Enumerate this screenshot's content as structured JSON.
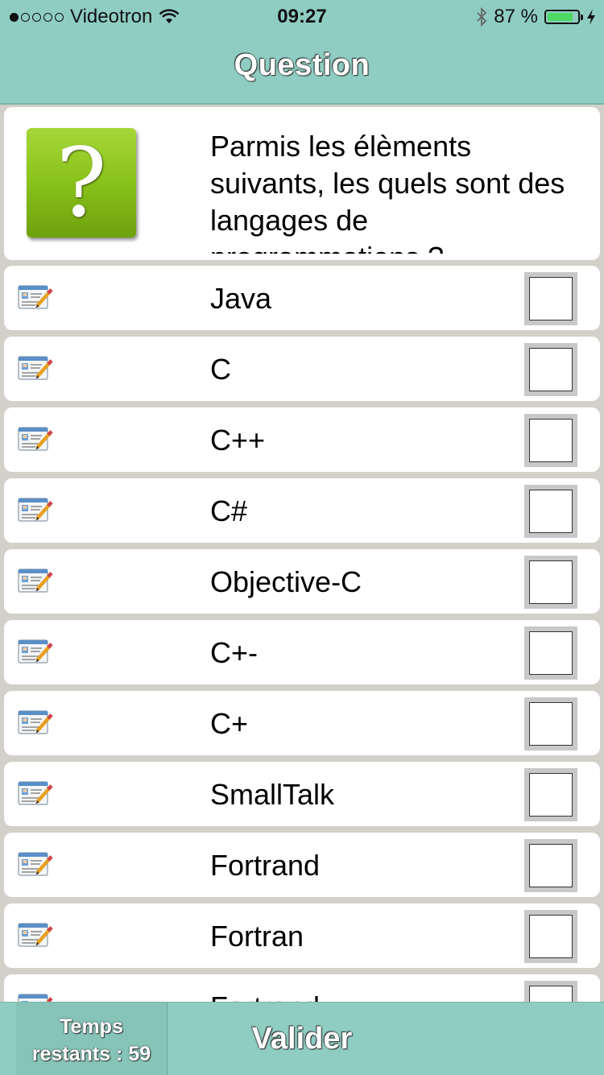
{
  "status_bar": {
    "carrier": "Videotron",
    "signal_dots_filled": 1,
    "signal_dots_total": 5,
    "time": "09:27",
    "battery_percent_label": "87 %",
    "battery_level": 0.87
  },
  "nav": {
    "title": "Question"
  },
  "question": {
    "text": "Parmis les élèments suivants, les quels sont des langages de programmations ?"
  },
  "options": [
    {
      "label": "Java",
      "checked": false
    },
    {
      "label": "C",
      "checked": false
    },
    {
      "label": "C++",
      "checked": false
    },
    {
      "label": "C#",
      "checked": false
    },
    {
      "label": "Objective-C",
      "checked": false
    },
    {
      "label": "C+-",
      "checked": false
    },
    {
      "label": "C+",
      "checked": false
    },
    {
      "label": "SmallTalk",
      "checked": false
    },
    {
      "label": "Fortrand",
      "checked": false
    },
    {
      "label": "Fortran",
      "checked": false
    },
    {
      "label": "Fortrand",
      "checked": false
    }
  ],
  "toolbar": {
    "timer_line1": "Temps",
    "timer_line2": "restants : 59",
    "validate_label": "Valider"
  },
  "colors": {
    "bar_background": "#8fcdc2",
    "page_background": "#d2d0c8",
    "question_icon": "#8bc51c"
  },
  "icons": {
    "question": "question-mark-icon",
    "option": "edit-document-icon"
  }
}
